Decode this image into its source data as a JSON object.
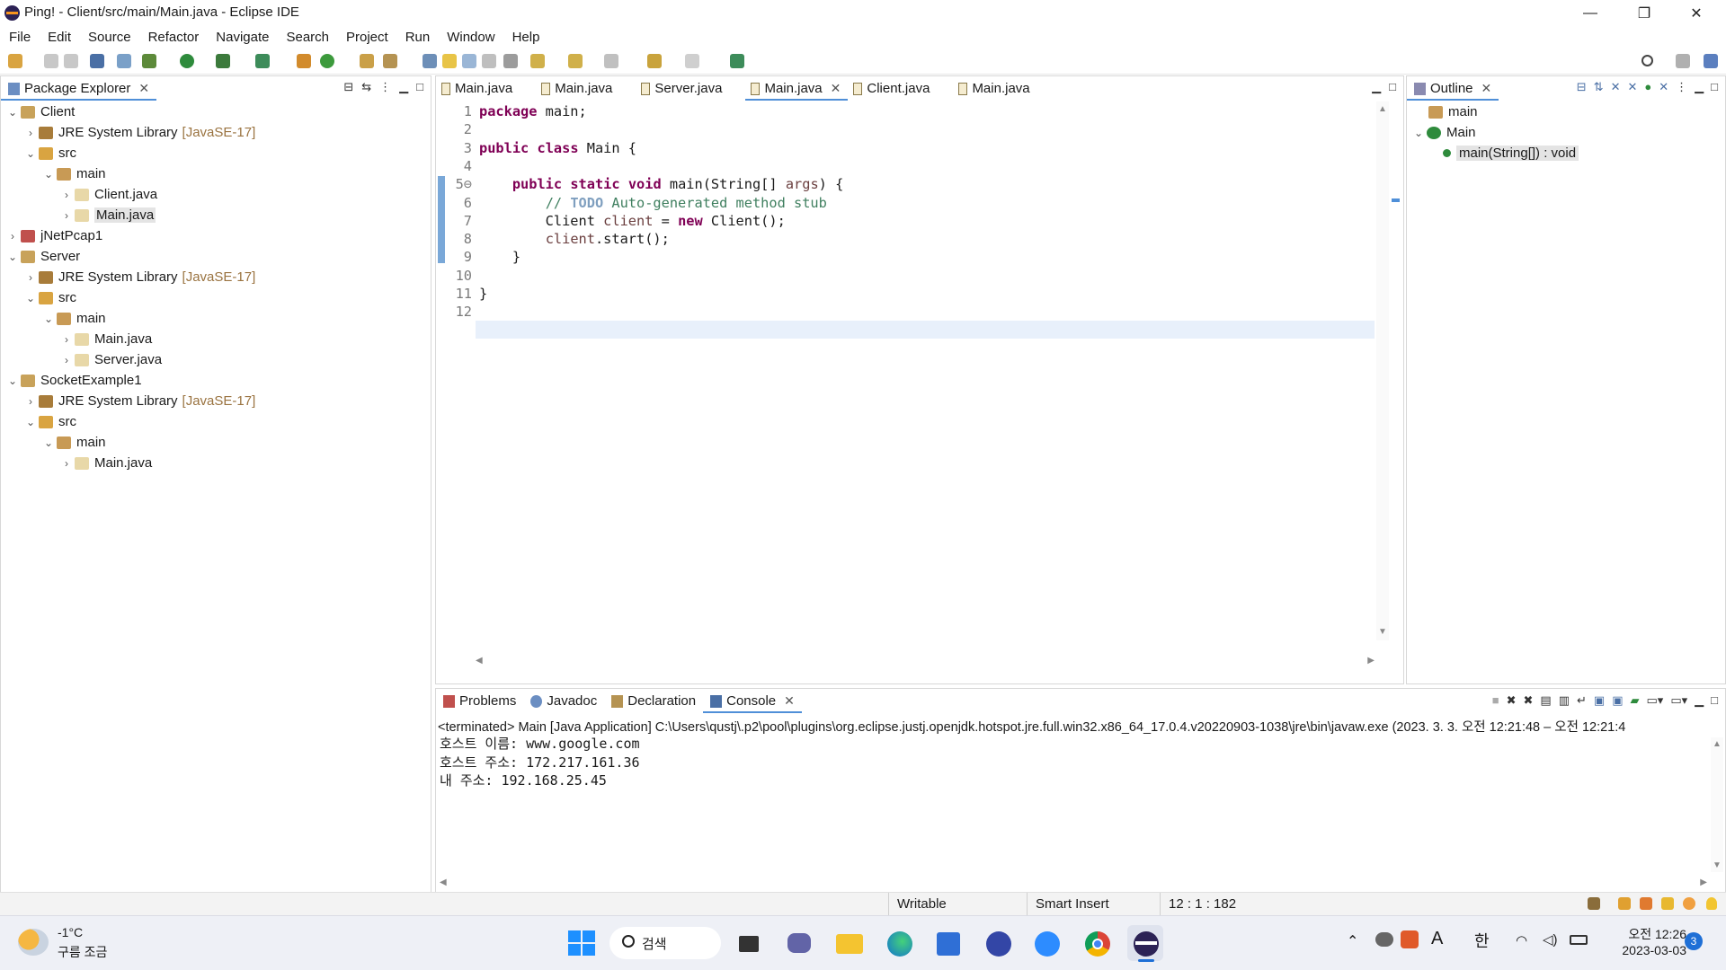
{
  "window": {
    "title": "Ping! - Client/src/main/Main.java - Eclipse IDE",
    "minimize": "—",
    "maximize": "❐",
    "close": "✕"
  },
  "menu": [
    "File",
    "Edit",
    "Source",
    "Refactor",
    "Navigate",
    "Search",
    "Project",
    "Run",
    "Window",
    "Help"
  ],
  "package_explorer": {
    "tab_label": "Package Explorer",
    "tree": [
      {
        "indent": 0,
        "twisty": "⌄",
        "icon": "project-icon",
        "label": "Client",
        "deco": ""
      },
      {
        "indent": 1,
        "twisty": "›",
        "icon": "library-icon",
        "label": "JRE System Library",
        "deco": "[JavaSE-17]"
      },
      {
        "indent": 1,
        "twisty": "⌄",
        "icon": "src-folder-icon",
        "label": "src",
        "deco": ""
      },
      {
        "indent": 2,
        "twisty": "⌄",
        "icon": "package-icon",
        "label": "main",
        "deco": ""
      },
      {
        "indent": 3,
        "twisty": "›",
        "icon": "java-file-icon",
        "label": "Client.java",
        "deco": ""
      },
      {
        "indent": 3,
        "twisty": "›",
        "icon": "java-file-icon",
        "label": "Main.java",
        "deco": "",
        "selected": true
      },
      {
        "indent": 0,
        "twisty": "›",
        "icon": "project-error-icon",
        "label": "jNetPcap1",
        "deco": ""
      },
      {
        "indent": 0,
        "twisty": "⌄",
        "icon": "project-icon",
        "label": "Server",
        "deco": ""
      },
      {
        "indent": 1,
        "twisty": "›",
        "icon": "library-icon",
        "label": "JRE System Library",
        "deco": "[JavaSE-17]"
      },
      {
        "indent": 1,
        "twisty": "⌄",
        "icon": "src-folder-icon",
        "label": "src",
        "deco": ""
      },
      {
        "indent": 2,
        "twisty": "⌄",
        "icon": "package-icon",
        "label": "main",
        "deco": ""
      },
      {
        "indent": 3,
        "twisty": "›",
        "icon": "java-file-icon",
        "label": "Main.java",
        "deco": ""
      },
      {
        "indent": 3,
        "twisty": "›",
        "icon": "java-file-icon",
        "label": "Server.java",
        "deco": ""
      },
      {
        "indent": 0,
        "twisty": "⌄",
        "icon": "project-icon",
        "label": "SocketExample1",
        "deco": ""
      },
      {
        "indent": 1,
        "twisty": "›",
        "icon": "library-icon",
        "label": "JRE System Library",
        "deco": "[JavaSE-17]"
      },
      {
        "indent": 1,
        "twisty": "⌄",
        "icon": "src-folder-icon",
        "label": "src",
        "deco": ""
      },
      {
        "indent": 2,
        "twisty": "⌄",
        "icon": "package-icon",
        "label": "main",
        "deco": ""
      },
      {
        "indent": 3,
        "twisty": "›",
        "icon": "java-file-icon",
        "label": "Main.java",
        "deco": ""
      }
    ]
  },
  "editor": {
    "tabs": [
      {
        "label": "Main.java",
        "active": false
      },
      {
        "label": "Main.java",
        "active": false
      },
      {
        "label": "Server.java",
        "active": false
      },
      {
        "label": "Main.java",
        "active": true
      },
      {
        "label": "Client.java",
        "active": false
      },
      {
        "label": "Main.java",
        "active": false
      }
    ],
    "line_numbers": [
      "1",
      "2",
      "3",
      "4",
      "5⊖",
      "6",
      "7",
      "8",
      "9",
      "10",
      "11",
      "12"
    ],
    "code": [
      "package main;",
      "",
      "public class Main {",
      "",
      "    public static void main(String[] args) {",
      "        // TODO Auto-generated method stub",
      "        Client client = new Client();",
      "        client.start();",
      "    }",
      "",
      "}",
      ""
    ]
  },
  "outline": {
    "tab_label": "Outline",
    "items": [
      {
        "label": "main",
        "icon": "package-icon"
      },
      {
        "label": "Main",
        "icon": "class-icon"
      },
      {
        "label": "main(String[]) : void",
        "icon": "method-icon"
      }
    ]
  },
  "bottom": {
    "tabs": [
      "Problems",
      "Javadoc",
      "Declaration",
      "Console"
    ],
    "console_header": "<terminated> Main [Java Application] C:\\Users\\qustj\\.p2\\pool\\plugins\\org.eclipse.justj.openjdk.hotspot.jre.full.win32.x86_64_17.0.4.v20220903-1038\\jre\\bin\\javaw.exe  (2023. 3. 3. 오전 12:21:48 – 오전 12:21:4",
    "console_lines": [
      "호스트 이름: www.google.com",
      "호스트 주소: 172.217.161.36",
      "내 주소: 192.168.25.45"
    ]
  },
  "status": {
    "writable": "Writable",
    "insert_mode": "Smart Insert",
    "position": "12 : 1 : 182"
  },
  "taskbar": {
    "weather_temp": "-1°C",
    "weather_desc": "구름 조금",
    "search_label": "검색",
    "ime": "한",
    "font_indicator": "A",
    "time": "오전 12:26",
    "date": "2023-03-03",
    "notification_count": "3"
  }
}
